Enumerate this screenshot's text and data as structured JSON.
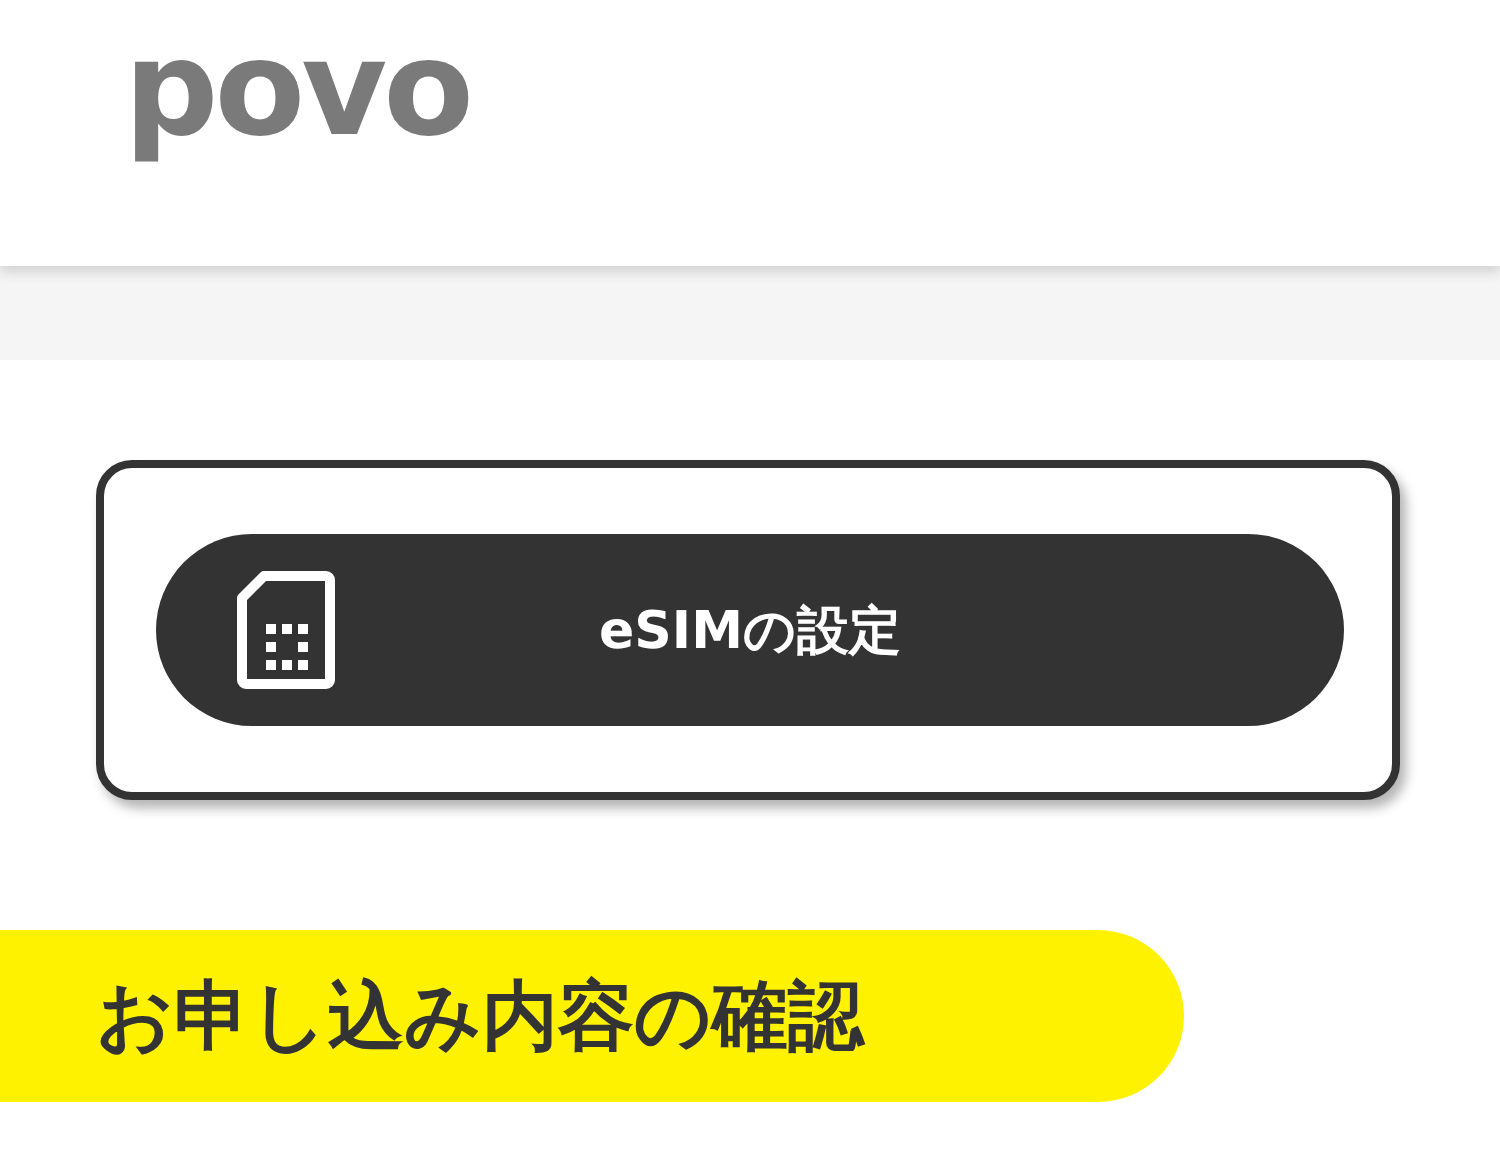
{
  "logo": {
    "text": "povo"
  },
  "esim_button": {
    "label": "eSIMの設定"
  },
  "section": {
    "title": "お申し込み内容の確認"
  }
}
